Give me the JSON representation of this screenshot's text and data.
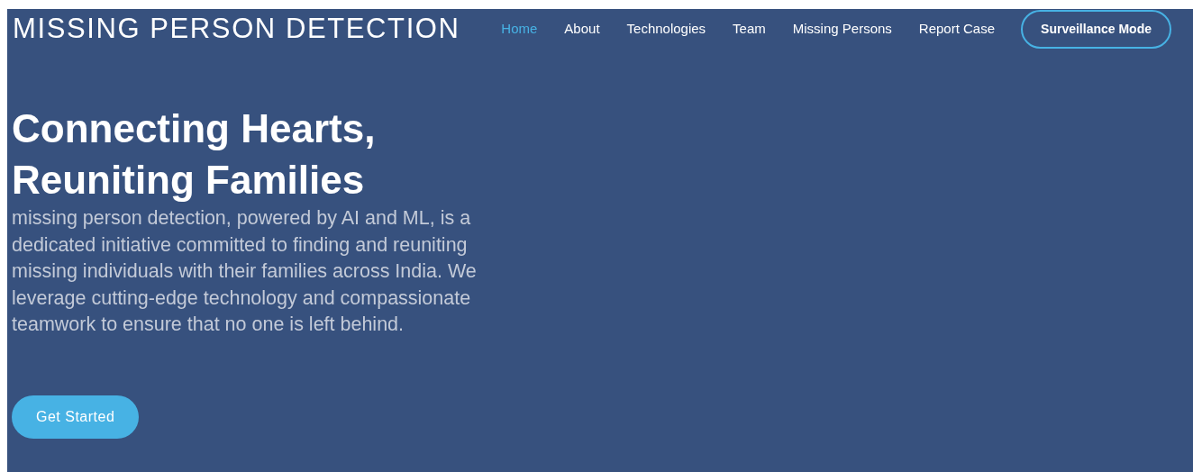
{
  "brand": "MISSING PERSON DETECTION",
  "nav": [
    {
      "label": "Home",
      "selected": true
    },
    {
      "label": "About",
      "selected": false
    },
    {
      "label": "Technologies",
      "selected": false
    },
    {
      "label": "Team",
      "selected": false
    },
    {
      "label": "Missing Persons",
      "selected": false
    },
    {
      "label": "Report Case",
      "selected": false
    }
  ],
  "nav_button": "Surveillance Mode",
  "hero": {
    "title_lines": [
      "Connecting Hearts,",
      "Reuniting Families"
    ],
    "description": "missing person detection, powered by AI and ML, is a dedicated initiative committed to finding and reuniting missing individuals with their families across India. We leverage cutting-edge technology and compassionate teamwork to ensure that no one is left behind.",
    "button": "Get Started"
  }
}
